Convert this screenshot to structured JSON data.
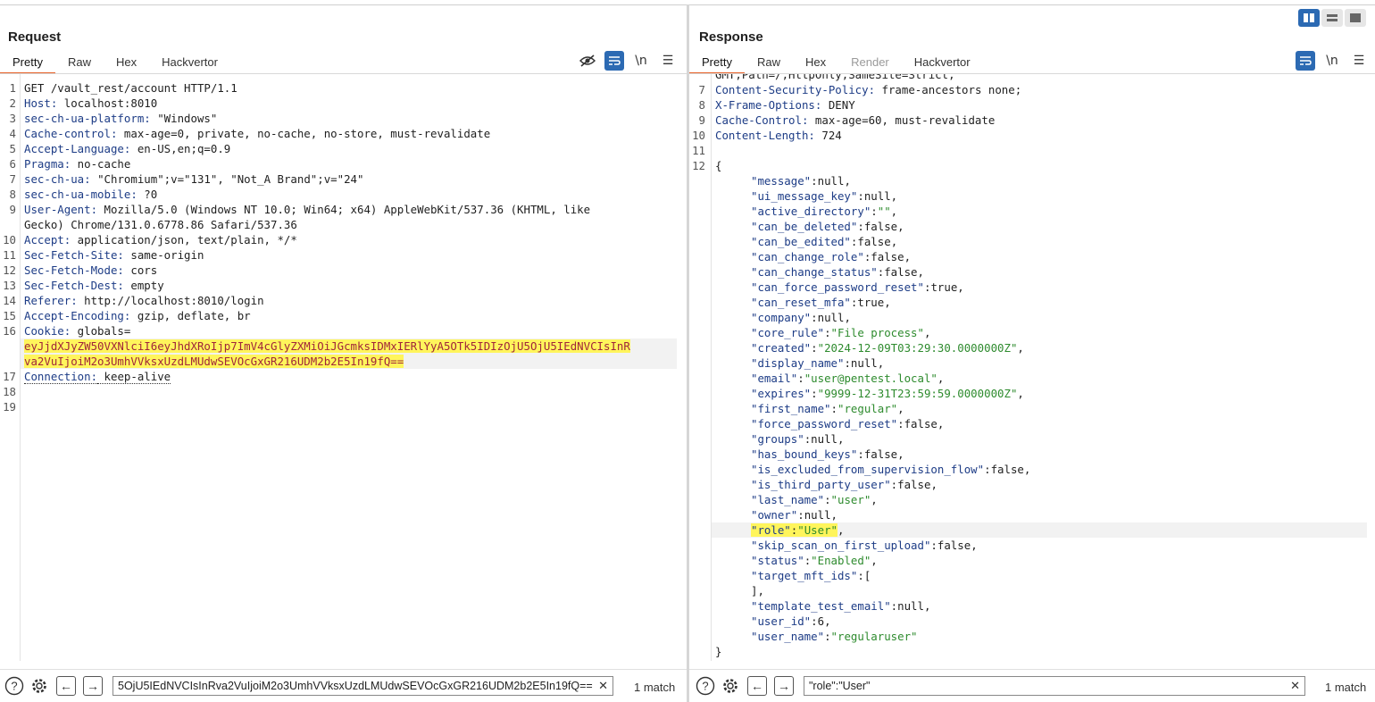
{
  "layout_buttons": [
    "side-by-side",
    "stacked-horizontal",
    "stacked-vertical"
  ],
  "request": {
    "title": "Request",
    "tabs": [
      "Pretty",
      "Raw",
      "Hex",
      "Hackvertor"
    ],
    "lines": [
      {
        "n": "1",
        "name": "",
        "value": "GET /vault_rest/account HTTP/1.1"
      },
      {
        "n": "2",
        "name": "Host:",
        "value": " localhost:8010"
      },
      {
        "n": "3",
        "name": "sec-ch-ua-platform:",
        "value": " \"Windows\""
      },
      {
        "n": "4",
        "name": "Cache-control:",
        "value": " max-age=0, private, no-cache, no-store, must-revalidate"
      },
      {
        "n": "5",
        "name": "Accept-Language:",
        "value": " en-US,en;q=0.9"
      },
      {
        "n": "6",
        "name": "Pragma:",
        "value": " no-cache"
      },
      {
        "n": "7",
        "name": "sec-ch-ua:",
        "value": " \"Chromium\";v=\"131\", \"Not_A Brand\";v=\"24\""
      },
      {
        "n": "8",
        "name": "sec-ch-ua-mobile:",
        "value": " ?0"
      },
      {
        "n": "9",
        "name": "User-Agent:",
        "value": " Mozilla/5.0 (Windows NT 10.0; Win64; x64) AppleWebKit/537.36 (KHTML, like"
      },
      {
        "n": "",
        "name": "",
        "value": "Gecko) Chrome/131.0.6778.86 Safari/537.36"
      },
      {
        "n": "10",
        "name": "Accept:",
        "value": " application/json, text/plain, */*"
      },
      {
        "n": "11",
        "name": "Sec-Fetch-Site:",
        "value": " same-origin"
      },
      {
        "n": "12",
        "name": "Sec-Fetch-Mode:",
        "value": " cors"
      },
      {
        "n": "13",
        "name": "Sec-Fetch-Dest:",
        "value": " empty"
      },
      {
        "n": "14",
        "name": "Referer:",
        "value": " http://localhost:8010/login"
      },
      {
        "n": "15",
        "name": "Accept-Encoding:",
        "value": " gzip, deflate, br"
      },
      {
        "n": "16",
        "name": "Cookie:",
        "value": " globals="
      },
      {
        "n": "",
        "name": "",
        "value": "eyJjdXJyZW50VXNlciI6eyJhdXRoIjp7ImV4cGlyZXMiOiJGcmksIDMxIERlYyA5OTk5IDIzOjU5OjU5IEdNVCIsInR",
        "hl": true
      },
      {
        "n": "",
        "name": "",
        "value": "va2VuIjoiM2o3UmhVVksxUzdLMUdwSEVOcGxGR216UDM2b2E5In19fQ==",
        "hl": true
      },
      {
        "n": "17",
        "name": "Connection:",
        "value": " keep-alive",
        "dotted": true
      },
      {
        "n": "18",
        "name": "",
        "value": ""
      },
      {
        "n": "19",
        "name": "",
        "value": ""
      }
    ],
    "search_value": "5OjU5IEdNVCIsInRva2VuIjoiM2o3UmhVVksxUzdLMUdwSEVOcGxGR216UDM2b2E5In19fQ==",
    "match_text": "1 match"
  },
  "response": {
    "title": "Response",
    "tabs": [
      "Pretty",
      "Raw",
      "Hex",
      "Render",
      "Hackvertor"
    ],
    "partial_top": "GMT;Path=/;HttpOnly;SameSite=Strict;",
    "header_lines": [
      {
        "n": "7",
        "name": "Content-Security-Policy:",
        "value": " frame-ancestors none;"
      },
      {
        "n": "8",
        "name": "X-Frame-Options:",
        "value": " DENY"
      },
      {
        "n": "9",
        "name": "Cache-Control:",
        "value": " max-age=60, must-revalidate"
      },
      {
        "n": "10",
        "name": "Content-Length:",
        "value": " 724"
      },
      {
        "n": "11",
        "name": "",
        "value": ""
      },
      {
        "n": "12",
        "name": "{",
        "value": ""
      }
    ],
    "json_lines": [
      {
        "k": "\"message\"",
        "v": "null",
        "str": false
      },
      {
        "k": "\"ui_message_key\"",
        "v": "null",
        "str": false
      },
      {
        "k": "\"active_directory\"",
        "v": "\"\"",
        "str": true
      },
      {
        "k": "\"can_be_deleted\"",
        "v": "false",
        "str": false
      },
      {
        "k": "\"can_be_edited\"",
        "v": "false",
        "str": false
      },
      {
        "k": "\"can_change_role\"",
        "v": "false",
        "str": false
      },
      {
        "k": "\"can_change_status\"",
        "v": "false",
        "str": false
      },
      {
        "k": "\"can_force_password_reset\"",
        "v": "true",
        "str": false
      },
      {
        "k": "\"can_reset_mfa\"",
        "v": "true",
        "str": false
      },
      {
        "k": "\"company\"",
        "v": "null",
        "str": false
      },
      {
        "k": "\"core_rule\"",
        "v": "\"File process\"",
        "str": true
      },
      {
        "k": "\"created\"",
        "v": "\"2024-12-09T03:29:30.0000000Z\"",
        "str": true
      },
      {
        "k": "\"display_name\"",
        "v": "null",
        "str": false
      },
      {
        "k": "\"email\"",
        "v": "\"user@pentest.local\"",
        "str": true
      },
      {
        "k": "\"expires\"",
        "v": "\"9999-12-31T23:59:59.0000000Z\"",
        "str": true
      },
      {
        "k": "\"first_name\"",
        "v": "\"regular\"",
        "str": true
      },
      {
        "k": "\"force_password_reset\"",
        "v": "false",
        "str": false
      },
      {
        "k": "\"groups\"",
        "v": "null",
        "str": false
      },
      {
        "k": "\"has_bound_keys\"",
        "v": "false",
        "str": false
      },
      {
        "k": "\"is_excluded_from_supervision_flow\"",
        "v": "false",
        "str": false
      },
      {
        "k": "\"is_third_party_user\"",
        "v": "false",
        "str": false
      },
      {
        "k": "\"last_name\"",
        "v": "\"user\"",
        "str": true
      },
      {
        "k": "\"owner\"",
        "v": "null",
        "str": false
      },
      {
        "k": "\"role\"",
        "v": "\"User\"",
        "str": true,
        "hl": true
      },
      {
        "k": "\"skip_scan_on_first_upload\"",
        "v": "false",
        "str": false
      },
      {
        "k": "\"status\"",
        "v": "\"Enabled\"",
        "str": true
      },
      {
        "k": "\"target_mft_ids\"",
        "v": "[",
        "str": false,
        "open": true
      },
      {
        "k": "",
        "v": "],",
        "str": false,
        "raw": true
      },
      {
        "k": "\"template_test_email\"",
        "v": "null",
        "str": false
      },
      {
        "k": "\"user_id\"",
        "v": "6",
        "str": false
      },
      {
        "k": "\"user_name\"",
        "v": "\"regularuser\"",
        "str": true,
        "last": true
      }
    ],
    "closing": "}",
    "search_value": "\"role\":\"User\"",
    "match_text": "1 match"
  }
}
